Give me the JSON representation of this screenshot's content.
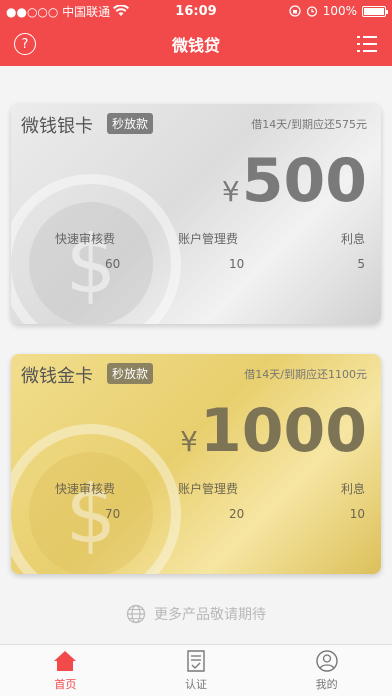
{
  "status": {
    "carrier": "●●○○○ 中国联通",
    "time": "16:09",
    "battery": "100%"
  },
  "nav": {
    "title": "微钱贷",
    "help_glyph": "?"
  },
  "cards": [
    {
      "name": "微钱银卡",
      "tag": "秒放款",
      "note": "借14天/到期应还575元",
      "currency": "¥",
      "amount": "500",
      "fees": [
        {
          "label": "快速审核费",
          "value": "60"
        },
        {
          "label": "账户管理费",
          "value": "10"
        },
        {
          "label": "利息",
          "value": "5"
        }
      ]
    },
    {
      "name": "微钱金卡",
      "tag": "秒放款",
      "note": "借14天/到期应还1100元",
      "currency": "¥",
      "amount": "1000",
      "fees": [
        {
          "label": "快速审核费",
          "value": "70"
        },
        {
          "label": "账户管理费",
          "value": "20"
        },
        {
          "label": "利息",
          "value": "10"
        }
      ]
    }
  ],
  "more_products": "更多产品敬请期待",
  "tabs": [
    {
      "label": "首页",
      "icon": "home-icon",
      "active": true
    },
    {
      "label": "认证",
      "icon": "document-icon",
      "active": false
    },
    {
      "label": "我的",
      "icon": "user-icon",
      "active": false
    }
  ],
  "colors": {
    "brand": "#f24a4a",
    "silver_card": "#dcdcdc",
    "gold_card": "#e8cf6e"
  }
}
